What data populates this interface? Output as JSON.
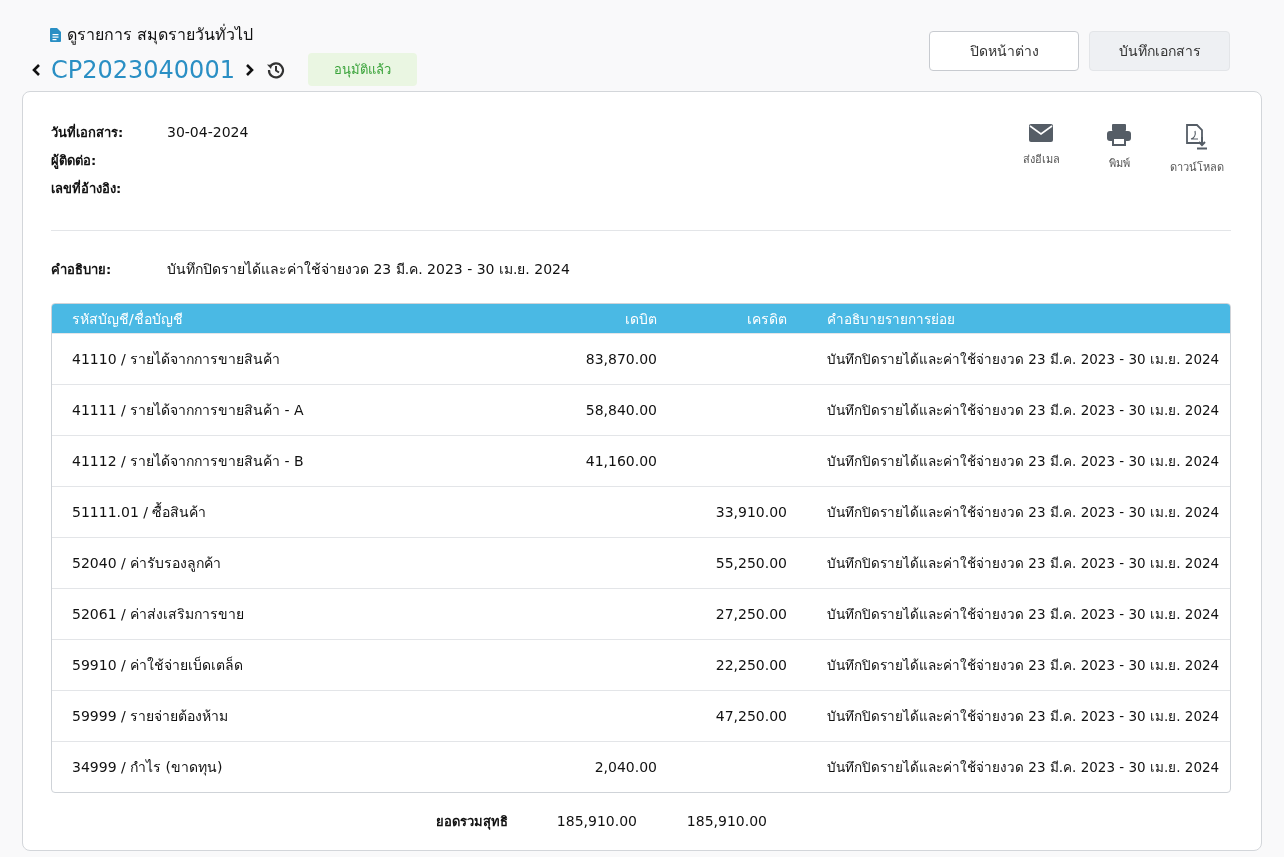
{
  "header": {
    "title": "ดูรายการ สมุดรายวันทั่วไป",
    "doc_no": "CP2023040001",
    "status": "อนุมัติแล้ว"
  },
  "buttons": [
    "ปิดหน้าต่าง",
    "บันทึกเอกสาร"
  ],
  "actions": [
    {
      "kind": "email",
      "label": "ส่งอีเมล"
    },
    {
      "kind": "print",
      "label": "พิมพ์"
    },
    {
      "kind": "download",
      "label": "ดาวน์โหลด"
    }
  ],
  "fields": [
    {
      "label": "วันที่เอกสาร:",
      "value": "30-04-2024"
    },
    {
      "label": "ผู้ติดต่อ:"
    },
    {
      "label": "เลขที่อ้างอิง:"
    }
  ],
  "description": {
    "label": "คำอธิบาย:",
    "value": "บันทึกปิดรายได้และค่าใช้จ่ายงวด 23 มี.ค. 2023 - 30 เม.ย. 2024"
  },
  "table": {
    "columns": [
      "รหัสบัญชี/ชื่อบัญชี",
      "เดบิต",
      "เครดิต",
      "คำอธิบายรายการย่อย"
    ],
    "rows": [
      {
        "account": "41110 / รายได้จากการขายสินค้า",
        "debit": "83,870.00",
        "note": "บันทึกปิดรายได้และค่าใช้จ่ายงวด 23 มี.ค. 2023 - 30 เม.ย. 2024"
      },
      {
        "account": "41111 / รายได้จากการขายสินค้า - A",
        "debit": "58,840.00",
        "note": "บันทึกปิดรายได้และค่าใช้จ่ายงวด 23 มี.ค. 2023 - 30 เม.ย. 2024"
      },
      {
        "account": "41112 / รายได้จากการขายสินค้า - B",
        "debit": "41,160.00",
        "note": "บันทึกปิดรายได้และค่าใช้จ่ายงวด 23 มี.ค. 2023 - 30 เม.ย. 2024"
      },
      {
        "account": "51111.01 / ซื้อสินค้า",
        "credit": "33,910.00",
        "note": "บันทึกปิดรายได้และค่าใช้จ่ายงวด 23 มี.ค. 2023 - 30 เม.ย. 2024"
      },
      {
        "account": "52040 / ค่ารับรองลูกค้า",
        "credit": "55,250.00",
        "note": "บันทึกปิดรายได้และค่าใช้จ่ายงวด 23 มี.ค. 2023 - 30 เม.ย. 2024"
      },
      {
        "account": "52061 / ค่าส่งเสริมการขาย",
        "credit": "27,250.00",
        "note": "บันทึกปิดรายได้และค่าใช้จ่ายงวด 23 มี.ค. 2023 - 30 เม.ย. 2024"
      },
      {
        "account": "59910 / ค่าใช้จ่ายเบ็ดเตล็ด",
        "credit": "22,250.00",
        "note": "บันทึกปิดรายได้และค่าใช้จ่ายงวด 23 มี.ค. 2023 - 30 เม.ย. 2024"
      },
      {
        "account": "59999 / รายจ่ายต้องห้าม",
        "credit": "47,250.00",
        "note": "บันทึกปิดรายได้และค่าใช้จ่ายงวด 23 มี.ค. 2023 - 30 เม.ย. 2024"
      },
      {
        "account": "34999 / กำไร (ขาดทุน)",
        "debit": "2,040.00",
        "note": "บันทึกปิดรายได้และค่าใช้จ่ายงวด 23 มี.ค. 2023 - 30 เม.ย. 2024"
      }
    ],
    "total": {
      "label": "ยอดรวมสุทธิ",
      "debit": "185,910.00",
      "credit": "185,910.00"
    }
  }
}
